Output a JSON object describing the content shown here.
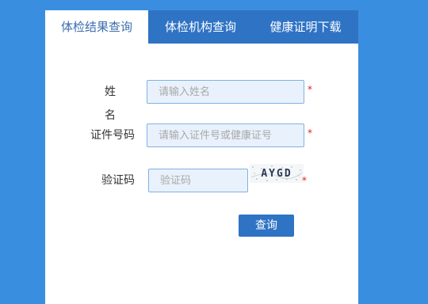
{
  "tabs": [
    {
      "label": "体检结果查询",
      "active": true
    },
    {
      "label": "体检机构查询",
      "active": false
    },
    {
      "label": "健康证明下载",
      "active": false
    }
  ],
  "form": {
    "name_label": "姓 名",
    "name_placeholder": "请输入姓名",
    "id_label": "证件号码",
    "id_placeholder": "请输入证件号或健康证号",
    "captcha_label": "验证码",
    "captcha_placeholder": "验证码",
    "captcha_text": "AYGD",
    "required_mark": "*",
    "submit_label": "查询"
  },
  "colors": {
    "background": "#3a8ee0",
    "tab_bar": "#2f73c5",
    "active_tab_text": "#3a6db0",
    "input_bg": "#e9f2fc",
    "input_border": "#7fb1e3",
    "required": "#e02020",
    "button": "#2f73c5"
  }
}
